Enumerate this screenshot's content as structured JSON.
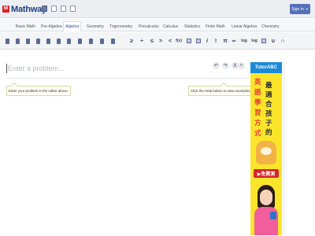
{
  "header": {
    "logo_box": "M",
    "logo_text": "Mathway",
    "signin_label": "Sign In",
    "icons": [
      "calculator-icon",
      "grid-icon",
      "list-icon",
      "keyboard-icon"
    ]
  },
  "tabs": [
    {
      "label": "Basic Math",
      "active": false
    },
    {
      "label": "Pre-Algebra",
      "active": false
    },
    {
      "label": "Algebra",
      "active": true
    },
    {
      "label": "Geometry",
      "active": false
    },
    {
      "label": "Trigonometry",
      "active": false
    },
    {
      "label": "Precalculus",
      "active": false
    },
    {
      "label": "Calculus",
      "active": false
    },
    {
      "label": "Statistics",
      "active": false
    },
    {
      "label": "Finite Math",
      "active": false
    },
    {
      "label": "Linear Algebra",
      "active": false
    },
    {
      "label": "Chemistry",
      "active": false
    }
  ],
  "symbols": {
    "ge": "≥",
    "le": "≤",
    "div": "÷",
    "dot": "·",
    "frac": "≤",
    "gt": ">",
    "lt": "<",
    "fx": "f(x)",
    "i": "i",
    "fact": "!",
    "pi": "π",
    "inf": "∞",
    "log": "log",
    "logb": "log",
    "cup": "∪",
    "cap": "∩"
  },
  "editor": {
    "placeholder": "Enter a problem...",
    "tip_left": "Enter your problem in the editor above.",
    "tip_right": "Click the Help button to view examples.",
    "buttons": {
      "undo": "↶",
      "redo": "↷",
      "clear": "X",
      "search": "⌕"
    }
  },
  "ad": {
    "brand": "TutorABC",
    "chars": [
      "英",
      "語",
      "學",
      "習",
      "方",
      "式",
      "最",
      "適",
      "合",
      "孩",
      "子",
      "的"
    ],
    "cta": "▶免費測",
    "colors": {
      "bg": "#fbe52b",
      "header": "#1d8ad6",
      "cta": "#d6232a"
    }
  },
  "colors": {
    "brand": "#1d3e83",
    "accent": "#5470b8",
    "active_tab": "#2c55a8"
  }
}
